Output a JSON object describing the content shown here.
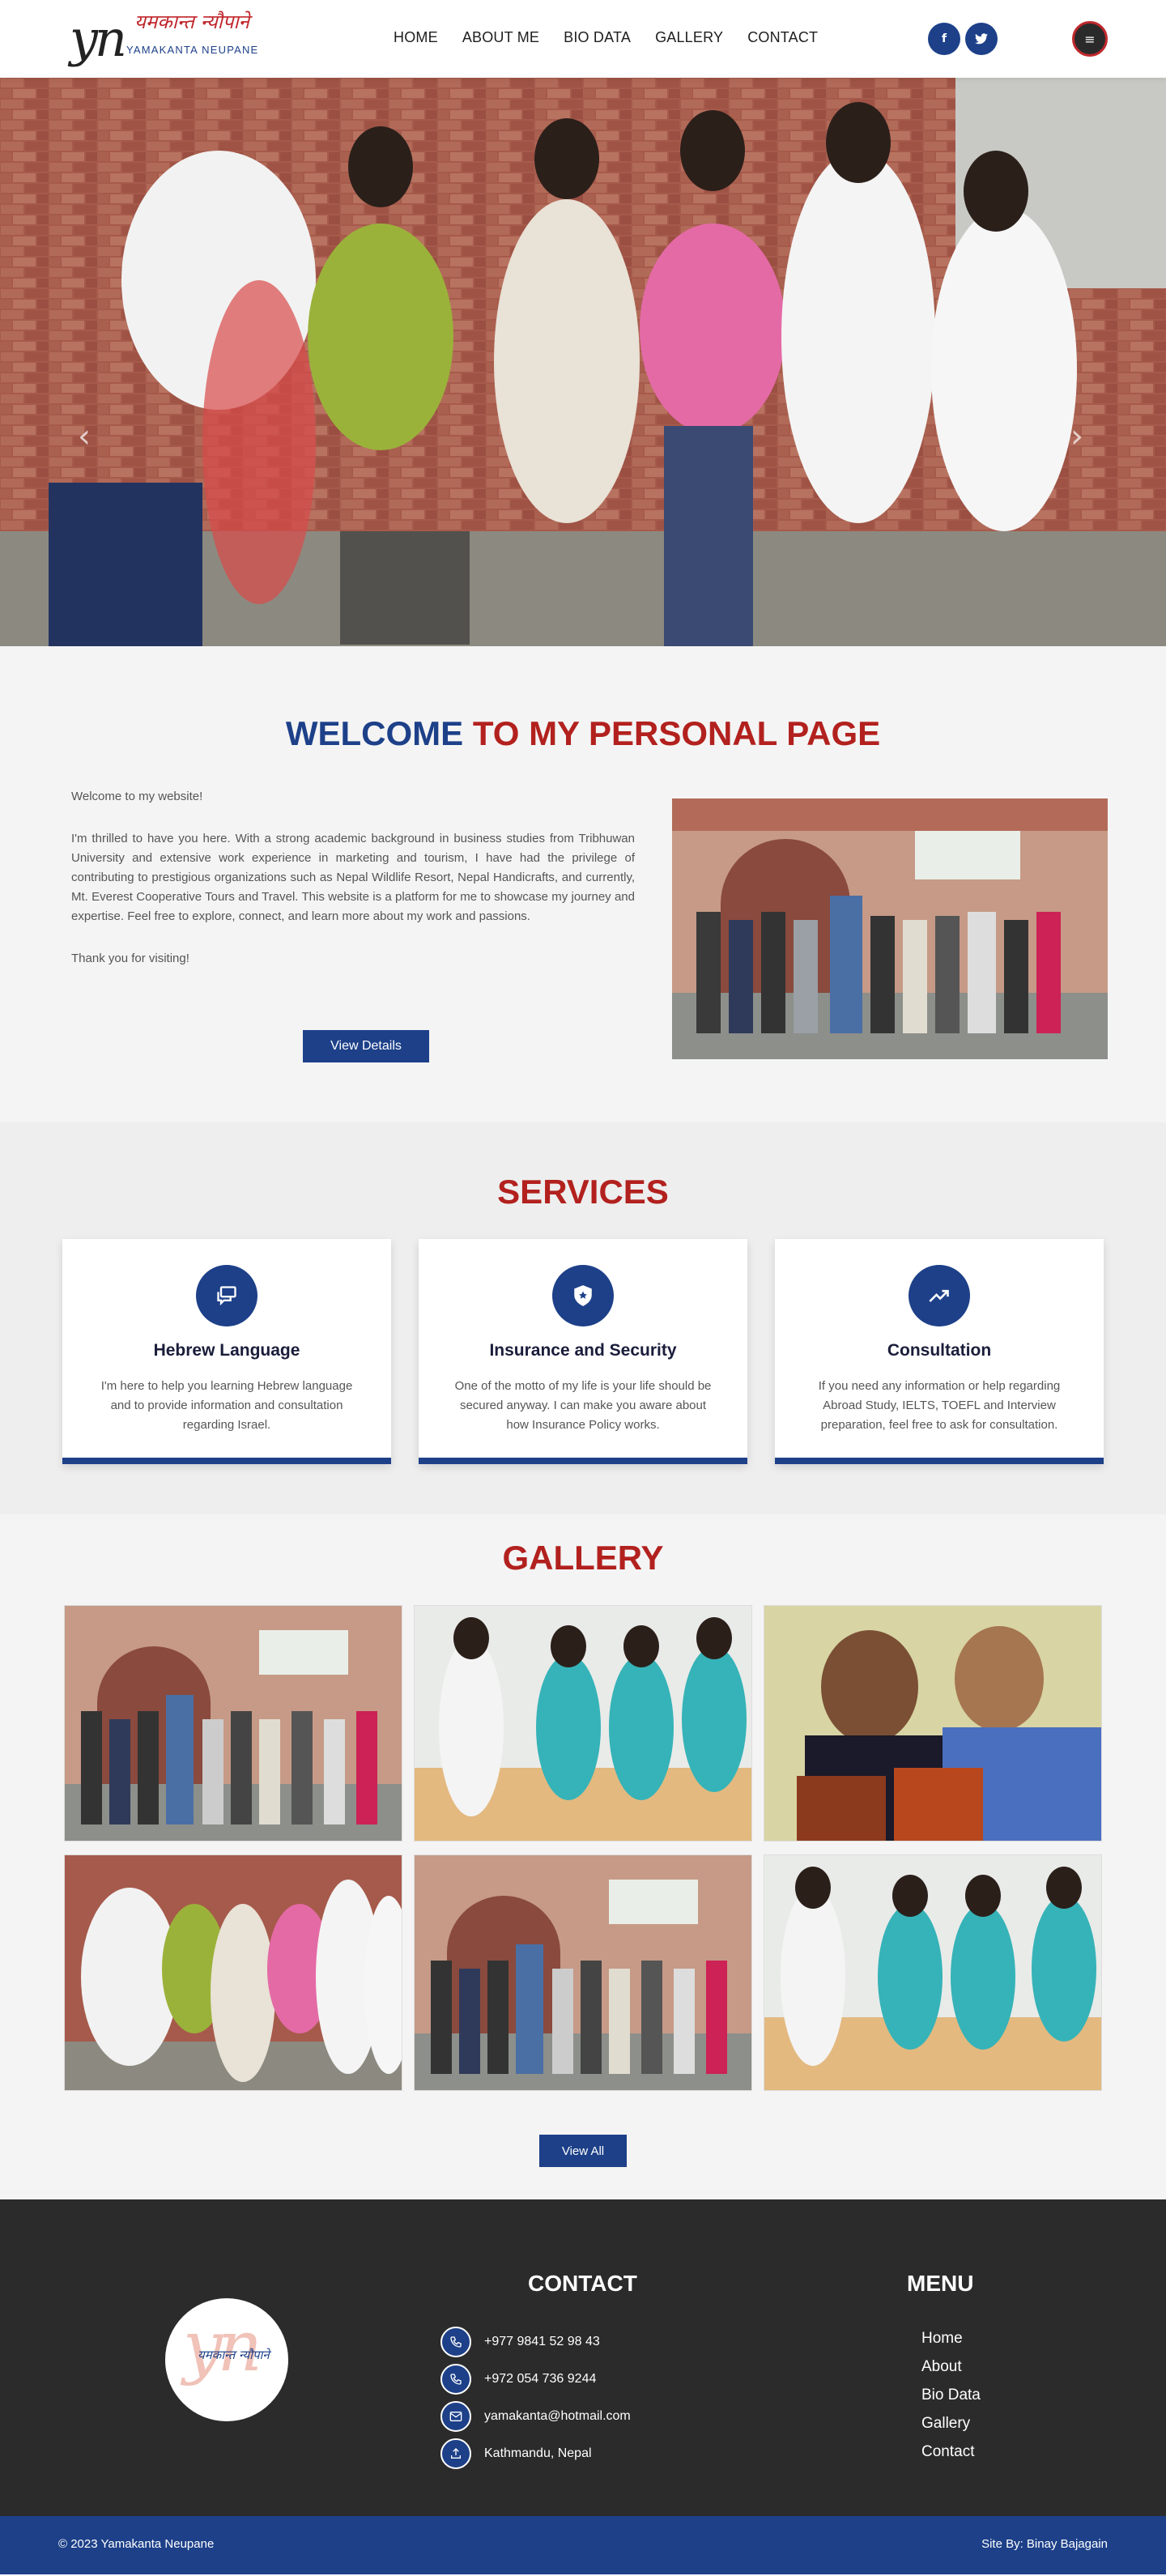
{
  "header": {
    "logo_mono": "yn",
    "logo_devanagari": "यमकान्त न्यौपाने",
    "logo_english": "YAMAKANTA NEUPANE",
    "nav": [
      "HOME",
      "ABOUT ME",
      "BIO DATA",
      "GALLERY",
      "CONTACT"
    ],
    "social_fb": "f",
    "social_tw": "t",
    "menu_icon": "≡"
  },
  "hero": {
    "prev_icon": "‹",
    "next_icon": "›"
  },
  "welcome": {
    "title_blue": "WELCOME",
    "title_red": "TO MY PERSONAL PAGE",
    "greeting": "Welcome to my website!",
    "body": "I'm thrilled to have you here. With a strong academic background in business studies from Tribhuwan University and extensive work experience in marketing and tourism, I have had the privilege of contributing to prestigious organizations such as Nepal Wildlife Resort, Nepal Handicrafts, and currently, Mt. Everest Cooperative Tours and Travel. This website is a platform for me to showcase my journey and expertise. Feel free to explore, connect, and learn more about my work and passions.",
    "thanks": "Thank you for visiting!",
    "button": "View Details"
  },
  "services": {
    "title": "SERVICES",
    "items": [
      {
        "icon": "chat-bubbles-icon",
        "title": "Hebrew Language",
        "text": "I'm here to help you learning Hebrew language and to provide information and consultation regarding Israel."
      },
      {
        "icon": "shield-icon",
        "title": "Insurance and Security",
        "text": "One of the motto of my life is your life should be secured anyway. I can make you aware about how Insurance Policy works."
      },
      {
        "icon": "trend-up-icon",
        "title": "Consultation",
        "text": "If you need any information or help regarding Abroad Study, IELTS, TOEFL and Interview preparation, feel free to ask for consultation."
      }
    ]
  },
  "gallery": {
    "title": "GALLERY",
    "button": "View All"
  },
  "footer": {
    "logo_mono": "yn",
    "logo_devanagari": "यमकान्त न्यौपाने",
    "contact_title": "CONTACT",
    "contact": [
      "+977 9841 52 98 43",
      "+972 054 736 9244",
      "yamakanta@hotmail.com",
      "Kathmandu, Nepal"
    ],
    "menu_title": "MENU",
    "menu": [
      "Home",
      "About",
      "Bio Data",
      "Gallery",
      "Contact"
    ],
    "copyright": "© 2023 Yamakanta Neupane",
    "site_by": "Site By: Binay Bajagain"
  }
}
